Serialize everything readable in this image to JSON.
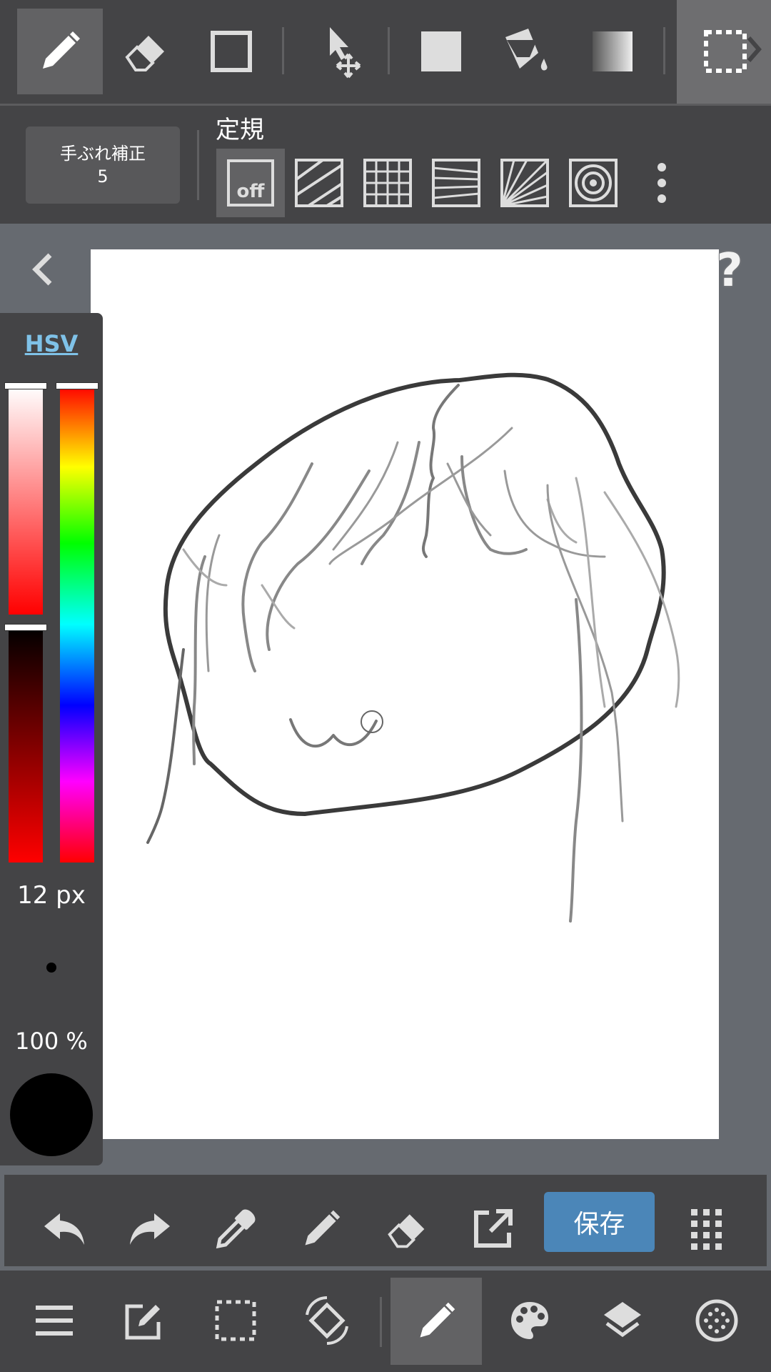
{
  "top_toolbar": {
    "tools": [
      {
        "name": "pen",
        "active": true
      },
      {
        "name": "eraser",
        "active": false
      },
      {
        "name": "shape",
        "active": false
      },
      {
        "name": "move",
        "active": false
      },
      {
        "name": "fill-rect",
        "active": false
      },
      {
        "name": "bucket",
        "active": false
      },
      {
        "name": "gradient",
        "active": false
      },
      {
        "name": "select",
        "active": false
      }
    ]
  },
  "stabilizer": {
    "label": "手ぶれ補正",
    "value": "5"
  },
  "ruler": {
    "title": "定規",
    "off_label": "off",
    "options": [
      "off",
      "parallel",
      "grid",
      "perspective",
      "radial",
      "concentric"
    ],
    "selected": "off"
  },
  "color_panel": {
    "mode_label": "HSV",
    "brush_size": "12 px",
    "opacity": "100 %",
    "current_color": "#000000"
  },
  "action_bar": {
    "save_label": "保存",
    "items": [
      "undo",
      "redo",
      "eyedropper",
      "pen",
      "eraser",
      "export",
      "save",
      "more"
    ]
  },
  "bottom_bar": {
    "items": [
      "menu",
      "edit",
      "selection",
      "rotate",
      "brush",
      "color",
      "layers",
      "material"
    ],
    "active": "brush"
  },
  "colors": {
    "toolbar_bg": "#444446",
    "workspace_bg": "#666a70",
    "accent": "#4b86b8",
    "hsv_link": "#7fc2e8"
  }
}
